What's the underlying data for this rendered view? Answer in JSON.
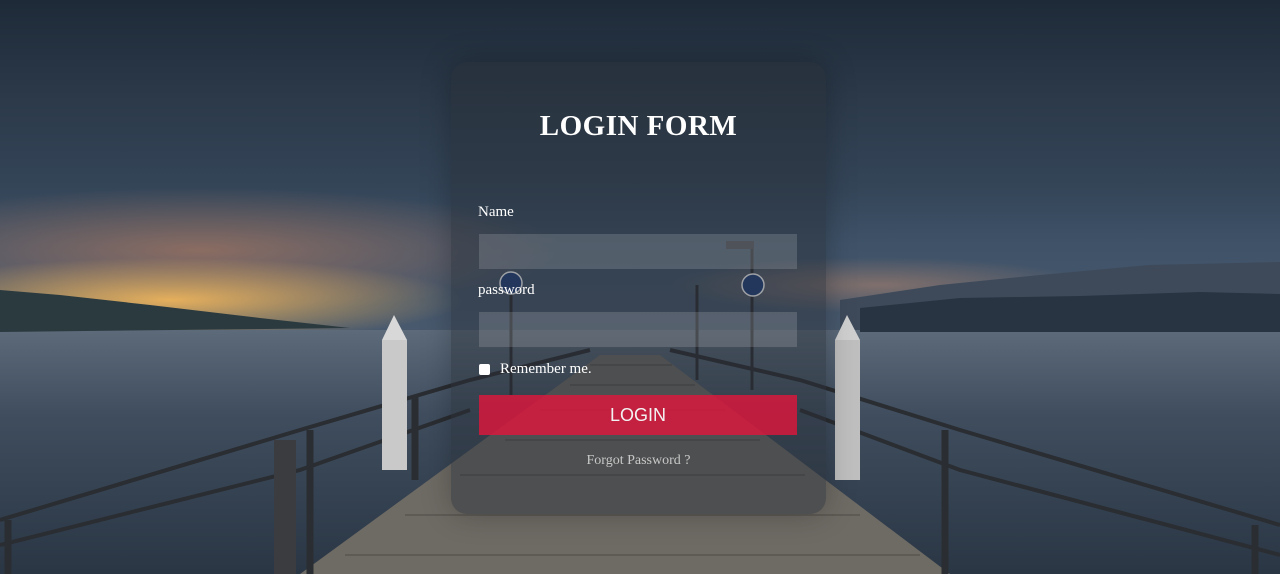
{
  "form": {
    "title": "LOGIN FORM",
    "name_label": "Name",
    "name_value": "",
    "password_label": "password",
    "password_value": "",
    "remember_label": "Remember me.",
    "remember_checked": false,
    "login_label": "LOGIN",
    "forgot_label": "Forgot Password ?"
  },
  "colors": {
    "login_button": "#de163c",
    "text": "#ffffff"
  },
  "background": {
    "subject": "pier-at-dusk-photo"
  }
}
